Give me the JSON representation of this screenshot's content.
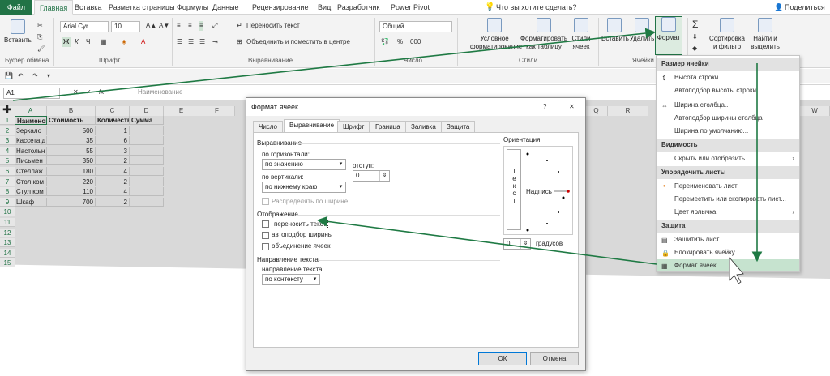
{
  "tabs": [
    "Файл",
    "Главная",
    "Вставка",
    "Разметка страницы",
    "Формулы",
    "Данные",
    "Рецензирование",
    "Вид",
    "Разработчик",
    "Power Pivot"
  ],
  "tell_me": "Что вы хотите сделать?",
  "share": "Поделиться",
  "ribbon": {
    "paste": "Вставить",
    "clipboard": "Буфер обмена",
    "font_name": "Arial Cyr",
    "font_size": "10",
    "font_group": "Шрифт",
    "wrap_text": "Переносить текст",
    "merge_center": "Объединить и поместить в центре",
    "alignment_group": "Выравнивание",
    "number_format": "Общий",
    "number_group": "Число",
    "conditional": "Условное форматирование",
    "format_table": "Форматировать как таблицу",
    "cell_styles": "Стили ячеек",
    "styles_group": "Стили",
    "insert": "Вставить",
    "delete": "Удалить",
    "format": "Формат",
    "cells_group": "Ячейки",
    "sort_filter": "Сортировка и фильтр",
    "find_select": "Найти и выделить"
  },
  "formula_bar": {
    "name_box": "A1",
    "fx": "fx",
    "content": "Наименование"
  },
  "columns": [
    "A",
    "B",
    "C",
    "D",
    "E",
    "F",
    "Q",
    "R",
    "W"
  ],
  "rows": [
    [
      "Наименование",
      "Стоимость",
      "Количество",
      "Сумма"
    ],
    [
      "Зеркало",
      "500",
      "1",
      ""
    ],
    [
      "Кассета д",
      "35",
      "6",
      ""
    ],
    [
      "Настольн",
      "55",
      "3",
      ""
    ],
    [
      "Письмен",
      "350",
      "2",
      ""
    ],
    [
      "Стеллаж",
      "180",
      "4",
      ""
    ],
    [
      "Стол ком",
      "220",
      "2",
      ""
    ],
    [
      "Стул ком",
      "110",
      "4",
      ""
    ],
    [
      "Шкаф",
      "700",
      "2",
      ""
    ]
  ],
  "row_numbers": [
    "1",
    "2",
    "3",
    "4",
    "5",
    "6",
    "7",
    "8",
    "9",
    "10",
    "11",
    "12",
    "13",
    "14",
    "15"
  ],
  "menu": {
    "h1": "Размер ячейки",
    "row_height": "Высота строки...",
    "autofit_row": "Автоподбор высоты строки",
    "col_width": "Ширина столбца...",
    "autofit_col": "Автоподбор ширины столбца",
    "default_width": "Ширина по умолчанию...",
    "h2": "Видимость",
    "hide_show": "Скрыть или отобразить",
    "h3": "Упорядочить листы",
    "rename": "Переименовать лист",
    "move_copy": "Переместить или скопировать лист...",
    "tab_color": "Цвет ярлычка",
    "h4": "Защита",
    "protect": "Защитить лист...",
    "lock": "Блокировать ячейку",
    "format_cells": "Формат ячеек..."
  },
  "dialog": {
    "title": "Формат ячеек",
    "help": "?",
    "close": "✕",
    "tabs": [
      "Число",
      "Выравнивание",
      "Шрифт",
      "Граница",
      "Заливка",
      "Защита"
    ],
    "alignment": "Выравнивание",
    "horizontal": "по горизонтали:",
    "horizontal_val": "по значению",
    "indent": "отступ:",
    "indent_val": "0",
    "vertical": "по вертикали:",
    "vertical_val": "по нижнему краю",
    "distributed": "Распределять по ширине",
    "display": "Отображение",
    "wrap": "переносить текст",
    "shrink": "автоподбор ширины",
    "merge": "объединение ячеек",
    "direction_section": "Направление текста",
    "direction": "направление текста:",
    "direction_val": "по контексту",
    "orientation": "Ориентация",
    "vertical_text": "Текст",
    "label_text": "Надпись",
    "degrees_val": "0",
    "degrees": "градусов",
    "ok": "ОК",
    "cancel": "Отмена"
  },
  "colors": {
    "accent": "#217346",
    "arrow": "#1f7a44",
    "selection": "#c6e3cf"
  }
}
